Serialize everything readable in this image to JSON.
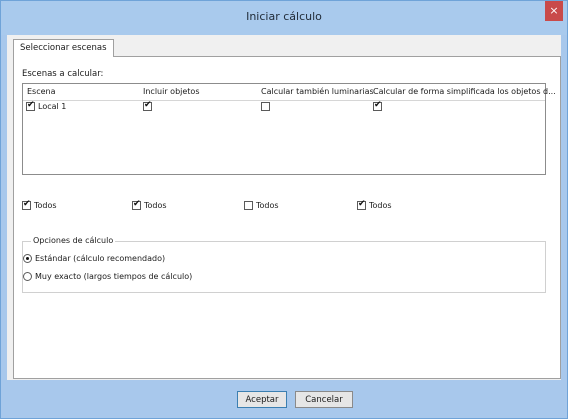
{
  "window": {
    "title": "Iniciar cálculo",
    "close_label": "×"
  },
  "tab": {
    "label": "Seleccionar escenas"
  },
  "scenes": {
    "section_label": "Escenas a calcular:",
    "columns": [
      "Escena",
      "Incluir objetos",
      "Calcular también luminarias",
      "Calcular de forma simplificada los objetos d..."
    ],
    "rows": [
      {
        "name": "Local 1",
        "escena": true,
        "incluir_objetos": true,
        "calcular_luminarias": false,
        "simplificada": true
      }
    ],
    "todos_label": "Todos",
    "todos": [
      true,
      true,
      false,
      true
    ]
  },
  "options": {
    "group_title": "Opciones de cálculo",
    "radios": [
      {
        "label": "Estándar (cálculo recomendado)",
        "selected": true
      },
      {
        "label": "Muy exacto (largos tiempos de cálculo)",
        "selected": false
      }
    ]
  },
  "buttons": {
    "ok": "Aceptar",
    "cancel": "Cancelar"
  }
}
